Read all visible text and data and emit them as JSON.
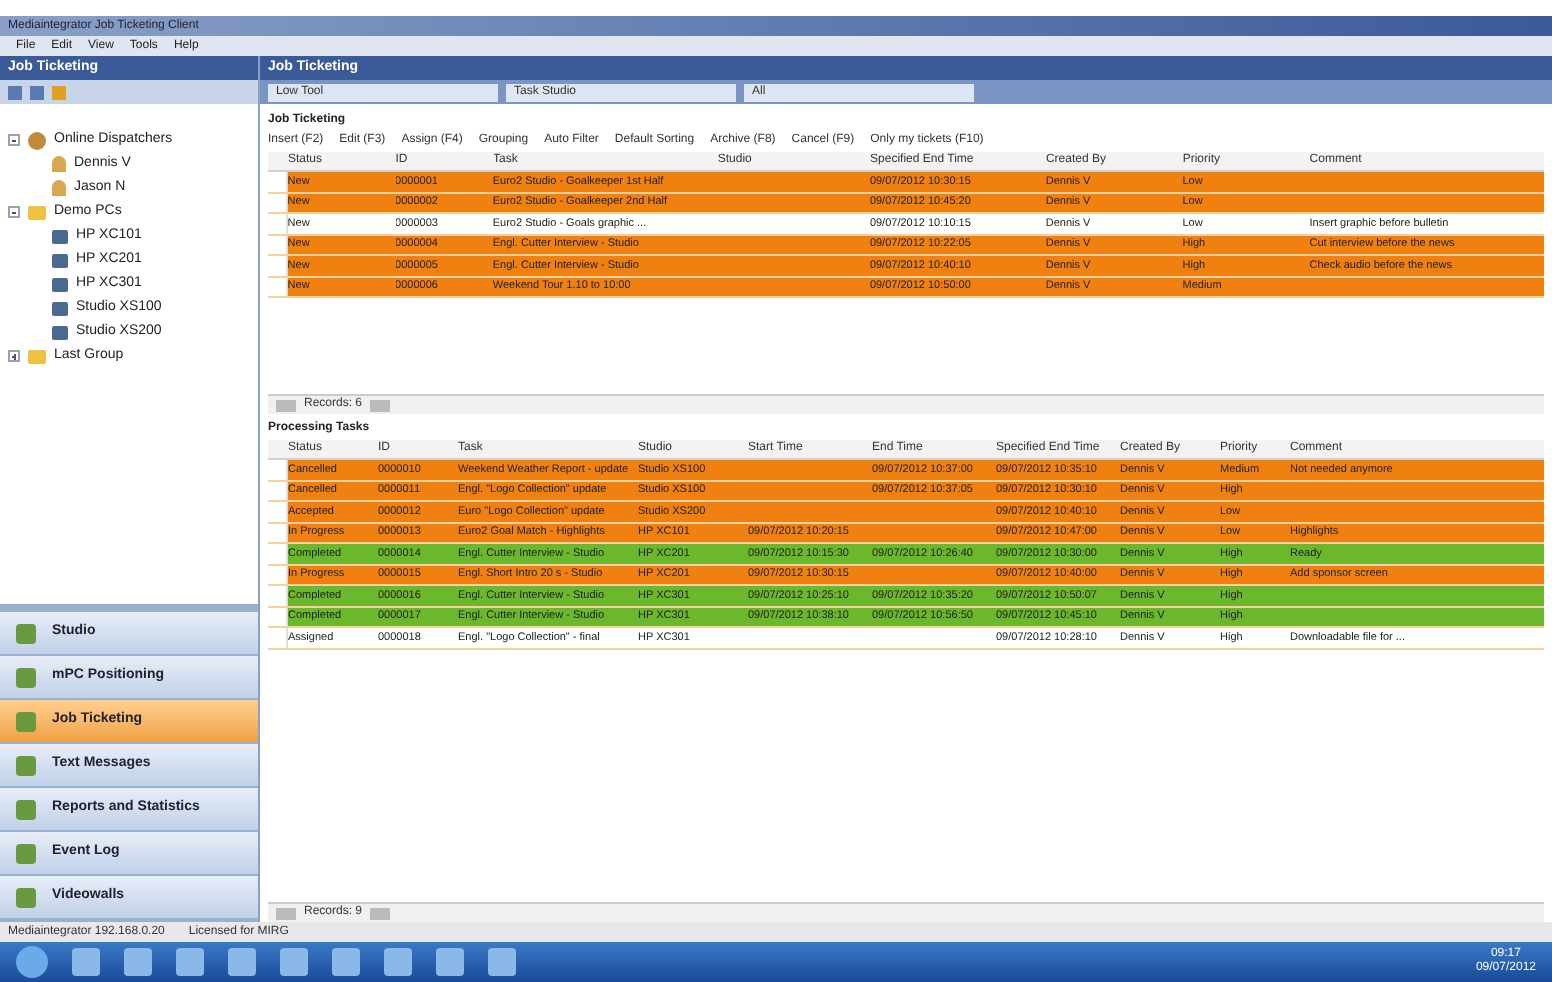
{
  "window": {
    "title": "Mediaintegrator Job Ticketing Client"
  },
  "menu": [
    "File",
    "Edit",
    "View",
    "Tools",
    "Help"
  ],
  "left_panel": {
    "title": "Job Ticketing",
    "tree": [
      {
        "label": "Online Dispatchers",
        "kind": "group",
        "expanded": true,
        "children": [
          {
            "label": "Dennis V",
            "kind": "user"
          },
          {
            "label": "Jason N",
            "kind": "user"
          }
        ]
      },
      {
        "label": "Demo PCs",
        "kind": "folder",
        "expanded": true,
        "children": [
          {
            "label": "HP XC101",
            "kind": "pc"
          },
          {
            "label": "HP XC201",
            "kind": "pc"
          },
          {
            "label": "HP XC301",
            "kind": "pc"
          },
          {
            "label": "Studio XS100",
            "kind": "pc"
          },
          {
            "label": "Studio XS200",
            "kind": "pc"
          }
        ]
      },
      {
        "label": "Last Group",
        "kind": "folder",
        "expanded": false
      }
    ],
    "nav": [
      {
        "label": "Studio",
        "selected": false
      },
      {
        "label": "mPC Positioning",
        "selected": false
      },
      {
        "label": "Job Ticketing",
        "selected": true
      },
      {
        "label": "Text Messages",
        "selected": false
      },
      {
        "label": "Reports and Statistics",
        "selected": false
      },
      {
        "label": "Event Log",
        "selected": false
      },
      {
        "label": "Videowalls",
        "selected": false
      }
    ]
  },
  "main": {
    "title": "Job Ticketing",
    "filters": [
      "Low Tool",
      "Task Studio",
      "All"
    ],
    "job_tickets": {
      "title": "Job Ticketing",
      "toolbar": [
        "Insert (F2)",
        "Edit (F3)",
        "Assign (F4)",
        "Grouping",
        "Auto Filter",
        "Default Sorting",
        "Archive (F8)",
        "Cancel (F9)",
        "Only my tickets (F10)"
      ],
      "columns": [
        "Status",
        "ID",
        "Task",
        "Studio",
        "Specified End Time",
        "Created By",
        "Priority",
        "Comment"
      ],
      "rows": [
        {
          "color": "#f08010",
          "cells": [
            "New",
            "0000001",
            "Euro2 Studio - Goalkeeper 1st Half",
            "",
            "09/07/2012 10:30:15",
            "Dennis V",
            "Low",
            ""
          ]
        },
        {
          "color": "#f08010",
          "cells": [
            "New",
            "0000002",
            "Euro2 Studio - Goalkeeper 2nd Half",
            "",
            "09/07/2012 10:45:20",
            "Dennis V",
            "Low",
            ""
          ]
        },
        {
          "color": "#ffffff",
          "cells": [
            "New",
            "0000003",
            "Euro2 Studio - Goals graphic ...",
            "",
            "09/07/2012 10:10:15",
            "Dennis V",
            "Low",
            "Insert graphic before bulletin"
          ]
        },
        {
          "color": "#f08010",
          "cells": [
            "New",
            "0000004",
            "Engl. Cutter Interview - Studio",
            "",
            "09/07/2012 10:22:05",
            "Dennis V",
            "High",
            "Cut interview before the news"
          ]
        },
        {
          "color": "#f08010",
          "cells": [
            "New",
            "0000005",
            "Engl. Cutter Interview - Studio",
            "",
            "09/07/2012 10:40:10",
            "Dennis V",
            "High",
            "Check audio before the news"
          ]
        },
        {
          "color": "#f08010",
          "cells": [
            "New",
            "0000006",
            "Weekend Tour 1.10 to 10:00",
            "",
            "09/07/2012 10:50:00",
            "Dennis V",
            "Medium",
            ""
          ]
        }
      ],
      "pager": "Records: 6"
    },
    "processing_tasks": {
      "title": "Processing Tasks",
      "columns": [
        "Status",
        "ID",
        "Task",
        "Studio",
        "Start Time",
        "End Time",
        "Specified End Time",
        "Created By",
        "Priority",
        "Comment"
      ],
      "rows": [
        {
          "color": "#f08010",
          "cells": [
            "Cancelled",
            "0000010",
            "Weekend Weather Report - update",
            "Studio XS100",
            "",
            "09/07/2012 10:37:00",
            "09/07/2012 10:35:10",
            "Dennis V",
            "Medium",
            "Not needed anymore"
          ]
        },
        {
          "color": "#f08010",
          "cells": [
            "Cancelled",
            "0000011",
            "Engl. \"Logo Collection\" update",
            "Studio XS100",
            "",
            "09/07/2012 10:37:05",
            "09/07/2012 10:30:10",
            "Dennis V",
            "High",
            ""
          ]
        },
        {
          "color": "#f08010",
          "cells": [
            "Accepted",
            "0000012",
            "Euro \"Logo Collection\" update",
            "Studio XS200",
            "",
            "",
            "09/07/2012 10:40:10",
            "Dennis V",
            "Low",
            ""
          ]
        },
        {
          "color": "#f08010",
          "cells": [
            "In Progress",
            "0000013",
            "Euro2 Goal Match - Highlights",
            "HP XC101",
            "09/07/2012 10:20:15",
            "",
            "09/07/2012 10:47:00",
            "Dennis V",
            "Low",
            "Highlights"
          ]
        },
        {
          "color": "#6cb82c",
          "cells": [
            "Completed",
            "0000014",
            "Engl. Cutter Interview - Studio",
            "HP XC201",
            "09/07/2012 10:15:30",
            "09/07/2012 10:26:40",
            "09/07/2012 10:30:00",
            "Dennis V",
            "High",
            "Ready"
          ]
        },
        {
          "color": "#f08010",
          "cells": [
            "In Progress",
            "0000015",
            "Engl. Short Intro 20 s - Studio",
            "HP XC201",
            "09/07/2012 10:30:15",
            "",
            "09/07/2012 10:40:00",
            "Dennis V",
            "High",
            "Add sponsor screen"
          ]
        },
        {
          "color": "#6cb82c",
          "cells": [
            "Completed",
            "0000016",
            "Engl. Cutter Interview - Studio",
            "HP XC301",
            "09/07/2012 10:25:10",
            "09/07/2012 10:35:20",
            "09/07/2012 10:50:07",
            "Dennis V",
            "High",
            ""
          ]
        },
        {
          "color": "#6cb82c",
          "cells": [
            "Completed",
            "0000017",
            "Engl. Cutter Interview - Studio",
            "HP XC301",
            "09/07/2012 10:38:10",
            "09/07/2012 10:56:50",
            "09/07/2012 10:45:10",
            "Dennis V",
            "High",
            ""
          ]
        },
        {
          "color": "#ffffff",
          "cells": [
            "Assigned",
            "0000018",
            "Engl. \"Logo Collection\" - final",
            "HP XC301",
            "",
            "",
            "09/07/2012 10:28:10",
            "Dennis V",
            "High",
            "Downloadable file for ..."
          ]
        }
      ],
      "pager": "Records: 9"
    }
  },
  "status_bar": {
    "server": "Mediaintegrator 192.168.0.20",
    "license": "Licensed for MIRG"
  },
  "taskbar": {
    "clock_time": "09:17",
    "clock_date": "09/07/2012"
  }
}
